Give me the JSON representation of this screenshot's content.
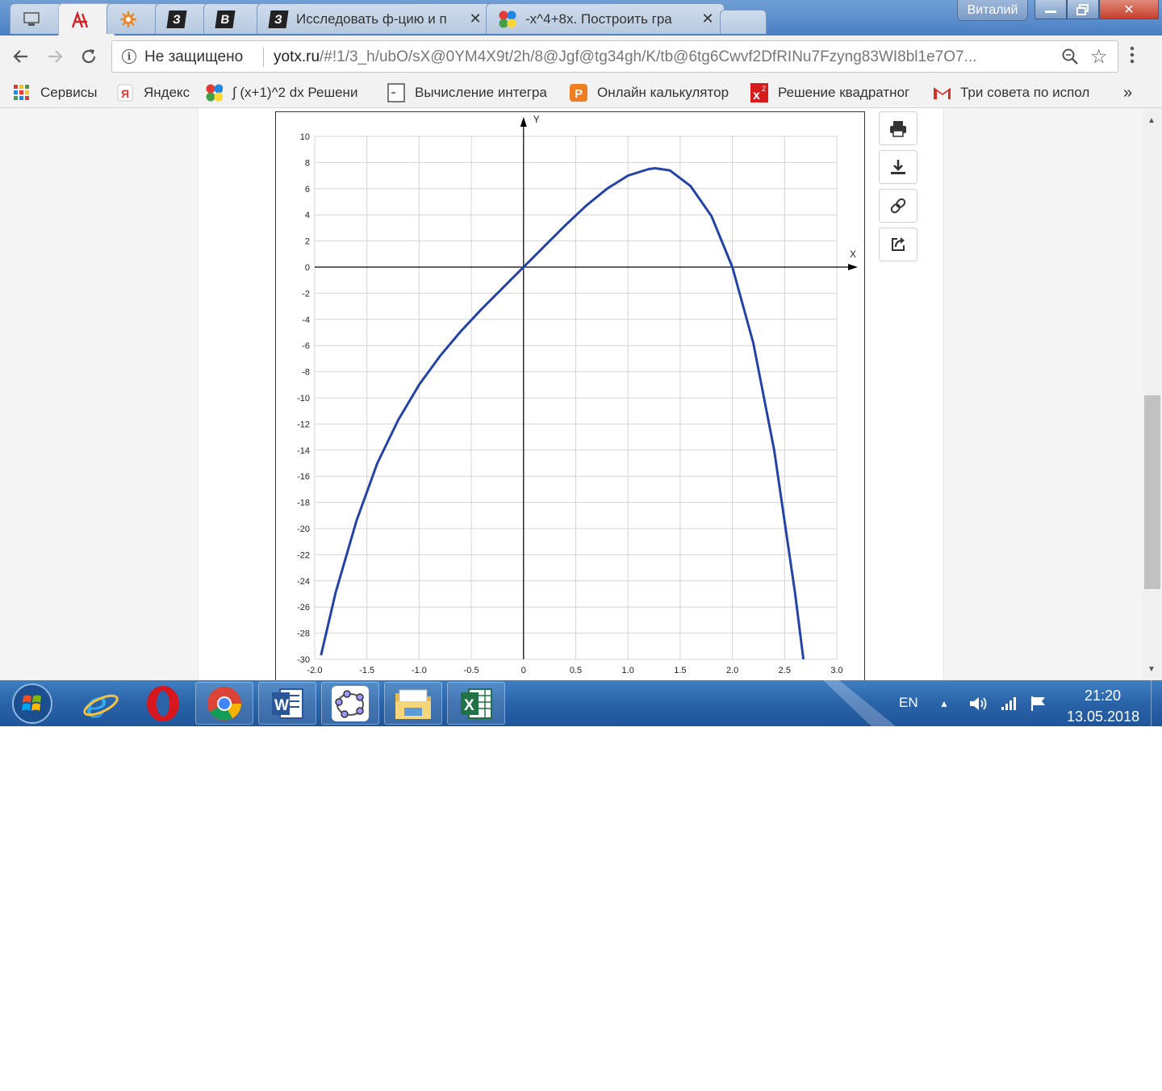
{
  "window": {
    "tabs": [
      {
        "icon": "monitor-icon",
        "title": "",
        "closable": false
      },
      {
        "icon": "red-logo-icon",
        "title": "",
        "closable": false,
        "active": true
      },
      {
        "icon": "sun-gear-icon",
        "title": "",
        "closable": false
      },
      {
        "icon": "z-letter-icon",
        "letter": "З",
        "title": "",
        "closable": false
      },
      {
        "icon": "v-letter-icon",
        "letter": "В",
        "title": "",
        "closable": false
      },
      {
        "icon": "z-letter-icon",
        "letter": "З",
        "title": "Исследовать ф-цию и п",
        "closable": true
      },
      {
        "icon": "colored-dots-icon",
        "title": "-x^4+8x. Построить гра",
        "closable": true
      }
    ],
    "profile_name": "Виталий"
  },
  "toolbar": {
    "security_label": "Не защищено",
    "url_host": "yotx.ru",
    "url_path": "/#!1/3_h/ubO/sX@0YM4X9t/2h/8@Jgf@tg34gh/K/tb@6tg6Cwvf2DfRINu7Fzyng83WI8bl1e7O7..."
  },
  "bookmarks": [
    {
      "icon": "apps-grid-icon",
      "label": "Сервисы"
    },
    {
      "icon": "yandex-icon",
      "label": "Яндекс"
    },
    {
      "icon": "colored-dots-icon",
      "label": "∫ (x+1)^2 dx Решени"
    },
    {
      "icon": "page-icon",
      "label": "Вычисление интегра"
    },
    {
      "icon": "orange-p-icon",
      "label": "Онлайн калькулятор"
    },
    {
      "icon": "red-x2-icon",
      "label": "Решение квадратног"
    },
    {
      "icon": "gmail-icon",
      "label": "Три совета по испол"
    }
  ],
  "bookmarks_more": "»",
  "chart_data": {
    "type": "line",
    "function": "-x^4+8x",
    "xlabel": "X",
    "ylabel": "Y",
    "xlim": [
      -2.0,
      3.0
    ],
    "ylim": [
      -30,
      10
    ],
    "x_ticks": [
      "-2.0",
      "-1.5",
      "-1.0",
      "-0.5",
      "0",
      "0.5",
      "1.0",
      "1.5",
      "2.0",
      "2.5",
      "3.0"
    ],
    "y_ticks": [
      "10",
      "8",
      "6",
      "4",
      "2",
      "0",
      "-2",
      "-4",
      "-6",
      "-8",
      "-10",
      "-12",
      "-14",
      "-16",
      "-18",
      "-20",
      "-22",
      "-24",
      "-26",
      "-28",
      "-30"
    ],
    "series": [
      {
        "color": "#2443a8",
        "x": [
          -1.94,
          -1.8,
          -1.6,
          -1.4,
          -1.2,
          -1.0,
          -0.8,
          -0.6,
          -0.4,
          -0.2,
          0.0,
          0.2,
          0.4,
          0.6,
          0.8,
          1.0,
          1.2,
          1.26,
          1.4,
          1.6,
          1.8,
          2.0,
          2.2,
          2.4,
          2.6,
          2.68
        ],
        "y": [
          -29.7,
          -24.9,
          -19.4,
          -15.0,
          -11.7,
          -9.0,
          -6.8,
          -4.9,
          -3.2,
          -1.6,
          0.0,
          1.6,
          3.2,
          4.7,
          6.0,
          7.0,
          7.5,
          7.56,
          7.4,
          6.2,
          3.9,
          0.0,
          -5.8,
          -14.0,
          -24.9,
          -30.0
        ]
      }
    ],
    "grid": true
  },
  "side_buttons": [
    {
      "icon": "print-icon"
    },
    {
      "icon": "download-icon"
    },
    {
      "icon": "link-icon"
    },
    {
      "icon": "share-icon"
    }
  ],
  "taskbar": {
    "apps": [
      "start-orb-icon",
      "ie-icon",
      "opera-icon",
      "chrome-icon",
      "word-icon",
      "geogebra-icon",
      "explorer-icon",
      "excel-icon"
    ],
    "lang": "EN",
    "time": "21:20",
    "date": "13.05.2018"
  }
}
